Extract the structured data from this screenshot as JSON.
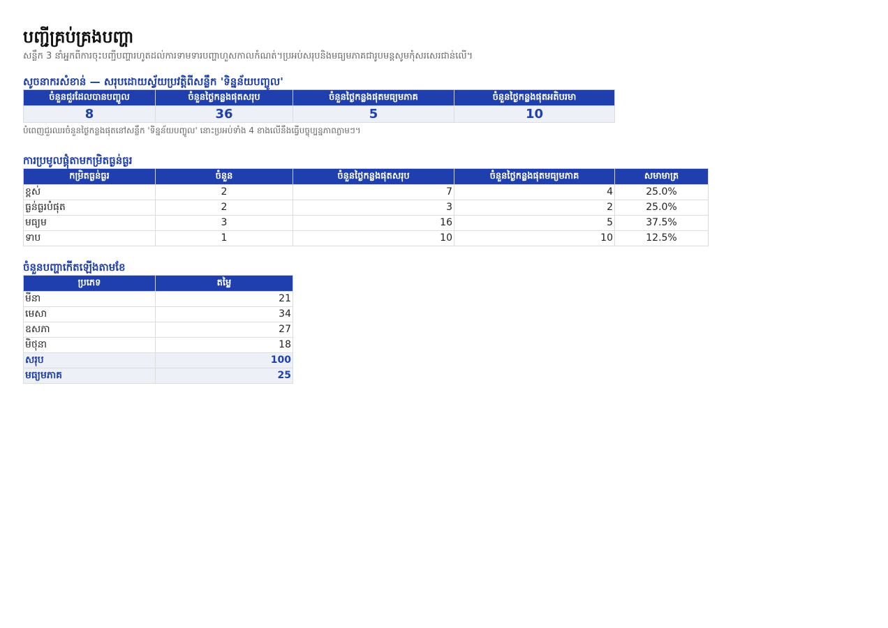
{
  "header": {
    "title": "បញ្ជីគ្រប់គ្រងបញ្ហា",
    "subtitle": "សន្លឹក 3 នាំអ្នកពីការចុះបញ្ជីបញ្ហារហូតដល់ការទាមទារបញ្ហាហួសកាលកំណត់។ប្រអប់សរុបនិងមធ្យមភាគជារូបមន្តសូមកុំសរសេរជាន់លើ។"
  },
  "kpi": {
    "title": "សូចនាករសំខាន់ — សរុបដោយស្វ័យប្រវត្តិពីសន្លឹក 'ទិន្នន័យបញ្ចូល'",
    "headers": [
      "ចំនួនជួរដែលបានបញ្ចូល",
      "ចំនួនថ្ងៃកន្លងផុតសរុប",
      "ចំនួនថ្ងៃកន្លងផុតមធ្យមភាគ",
      "ចំនួនថ្ងៃកន្លងផុតអតិបរមា"
    ],
    "values": [
      "8",
      "36",
      "5",
      "10"
    ],
    "note": "បំពេញជួរឈរចំនួនថ្ងៃកន្លងផុតនៅសន្លឹក 'ទិន្នន័យបញ្ចូល' នោះប្រអប់ទាំង 4 ខាងលើនឹងធ្វើបច្ចុប្បន្នភាពភ្លាមៗ។"
  },
  "priority": {
    "title": "ការប្រមូលផ្តុំតាមកម្រិតធ្ងន់ធ្ងរ",
    "headers": [
      "កម្រិតធ្ងន់ធ្ងរ",
      "ចំនួន",
      "ចំនួនថ្ងៃកន្លងផុតសរុប",
      "ចំនួនថ្ងៃកន្លងផុតមធ្យមភាគ",
      "សមាមាត្រ"
    ],
    "rows": [
      [
        "ខ្ពស់",
        "2",
        "7",
        "4",
        "25.0%"
      ],
      [
        "ធ្ងន់ធ្ងរបំផុត",
        "2",
        "3",
        "2",
        "25.0%"
      ],
      [
        "មធ្យម",
        "3",
        "16",
        "5",
        "37.5%"
      ],
      [
        "ទាប",
        "1",
        "10",
        "10",
        "12.5%"
      ]
    ]
  },
  "monthly": {
    "title": "ចំនួនបញ្ហាកើតឡើងតាមខែ",
    "headers": [
      "ប្រភេទ",
      "តម្លៃ"
    ],
    "rows": [
      [
        "មីនា",
        "21"
      ],
      [
        "មេសា",
        "34"
      ],
      [
        "ឧសភា",
        "27"
      ],
      [
        "មិថុនា",
        "18"
      ]
    ],
    "summary": [
      [
        "សរុប",
        "100"
      ],
      [
        "មធ្យមភាគ",
        "25"
      ]
    ]
  },
  "colors": {
    "accent": "#1f3fae",
    "header_text": "#ffffff",
    "summary_bg": "#eef0f8"
  }
}
